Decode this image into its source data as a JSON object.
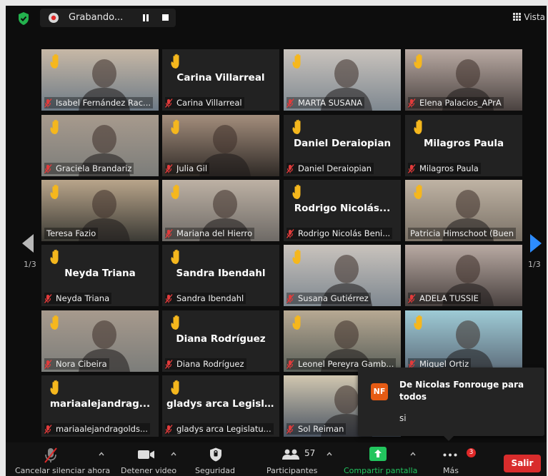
{
  "topbar": {
    "recording_label": "Grabando...",
    "view_label": "Vista",
    "icons": [
      "shield-icon",
      "record-icon",
      "pause-icon",
      "stop-icon",
      "grid-icon"
    ]
  },
  "pager": {
    "left": "1/3",
    "right": "1/3"
  },
  "participants": [
    {
      "name": "Isabel Fernández Rac...",
      "video": true,
      "hand": true
    },
    {
      "name": "Carina Villarreal",
      "video": false,
      "hand": true
    },
    {
      "name": "MARTA SUSANA",
      "video": true,
      "hand": true
    },
    {
      "name": "Elena Palacios_APrA",
      "video": true,
      "hand": true
    },
    {
      "name": "Graciela Brandariz",
      "video": true,
      "hand": true
    },
    {
      "name": "Julia Gil",
      "video": true,
      "hand": true
    },
    {
      "name": "Daniel Deraiopian",
      "video": false,
      "hand": true
    },
    {
      "name": "Milagros Paula",
      "video": false,
      "hand": true
    },
    {
      "name": "Teresa Fazio",
      "video": true,
      "hand": true,
      "muted_icon": false
    },
    {
      "name": "Mariana del Hierro",
      "video": true,
      "hand": true
    },
    {
      "name": "Rodrigo Nicolás Beni...",
      "tile_title": "Rodrigo  Nicolás...",
      "video": false,
      "hand": true
    },
    {
      "name": "Patricia Himschoot (Buen",
      "video": true,
      "hand": true,
      "muted_icon": false
    },
    {
      "name": "Neyda Triana",
      "video": false,
      "hand": true
    },
    {
      "name": "Sandra Ibendahl",
      "video": false,
      "hand": true
    },
    {
      "name": "Susana Gutiérrez",
      "video": true,
      "hand": true
    },
    {
      "name": "ADELA TUSSIE",
      "video": true,
      "hand": false
    },
    {
      "name": "Nora Cibeira",
      "video": true,
      "hand": true
    },
    {
      "name": "Diana Rodríguez",
      "video": false,
      "hand": true
    },
    {
      "name": "Leonel Pereyra Gamb...",
      "video": true,
      "hand": true
    },
    {
      "name": "Miguel Ortiz",
      "video": true,
      "hand": true
    },
    {
      "name": "mariaalejandragolds...",
      "tile_title": "mariaalejandrag...",
      "video": false,
      "hand": true
    },
    {
      "name": "gladys arca Legislatu...",
      "video": false,
      "hand": true
    },
    {
      "name": "Sol Reiman",
      "video": true,
      "hand": false
    }
  ],
  "chat": {
    "initials": "NF",
    "from": "De Nicolas Fonrouge para todos",
    "message": "si",
    "avatar_color": "#e65b14"
  },
  "toolbar": {
    "unmute_label": "Cancelar silenciar ahora",
    "video_label": "Detener video",
    "security_label": "Seguridad",
    "participants_label": "Participantes",
    "participants_count": "57",
    "share_label": "Compartir pantalla",
    "more_label": "Más",
    "more_badge": "3",
    "leave_label": "Salir",
    "share_color": "#22c55e",
    "leave_color": "#d92c2c"
  }
}
